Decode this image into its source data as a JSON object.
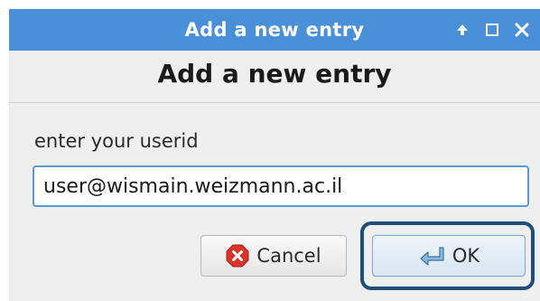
{
  "window": {
    "title": "Add a new entry",
    "controls": {
      "pin": "pin-up-arrow",
      "maximize": "maximize",
      "close": "close"
    }
  },
  "dialog": {
    "heading": "Add a new entry",
    "prompt": "enter your userid",
    "userid_value": "user@wismain.weizmann.ac.il",
    "cancel_label": "Cancel",
    "ok_label": "OK"
  },
  "colors": {
    "titlebar": "#4a90d9",
    "focus_ring": "#1f4e79",
    "cancel_icon": "#d9342b"
  }
}
